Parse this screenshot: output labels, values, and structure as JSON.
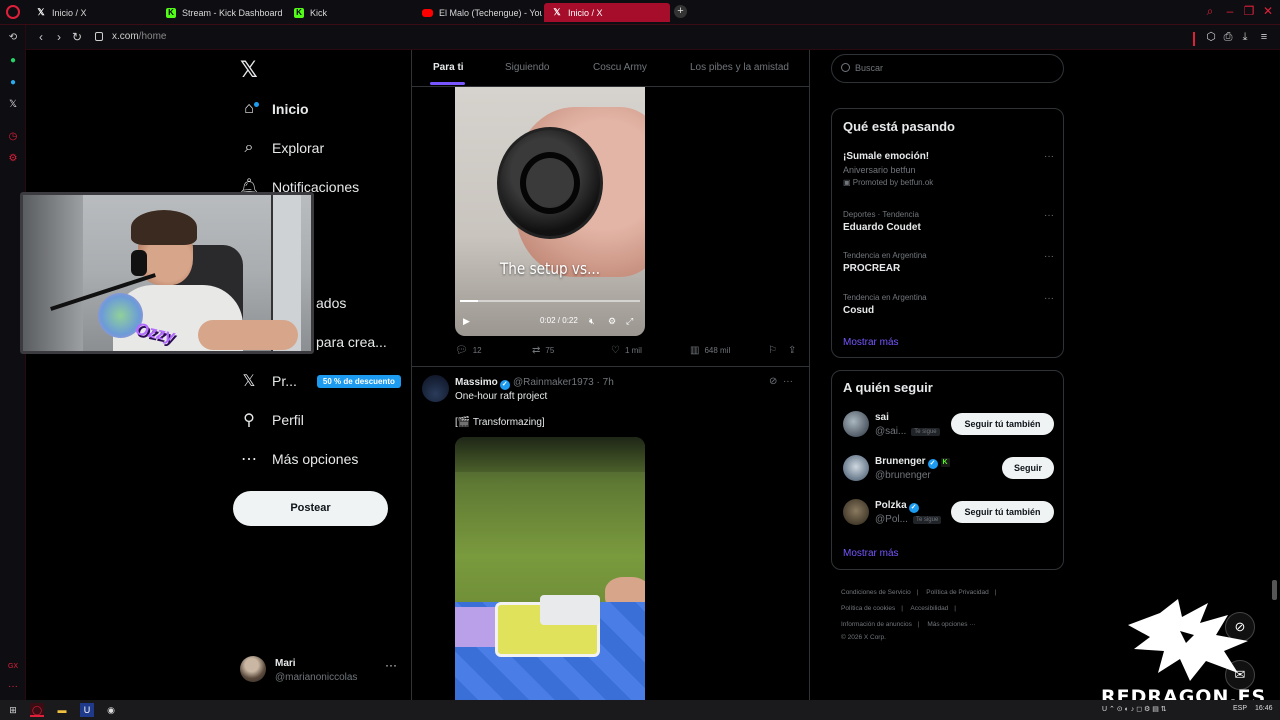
{
  "browser": {
    "tabs": [
      {
        "label": "Inicio / X",
        "icon": "x-logo-icon"
      },
      {
        "label": "Stream - Kick Dashboard",
        "icon": "kick-icon"
      },
      {
        "label": "Kick",
        "icon": "kick-icon"
      },
      {
        "label": "El Malo (Techengue) - You",
        "icon": "youtube-icon"
      },
      {
        "label": "Inicio / X",
        "icon": "x-logo-icon",
        "active": true
      }
    ],
    "new_tab": "+",
    "url_host": "x.com",
    "url_path": "/home",
    "accent": "#e0203a"
  },
  "nav": {
    "items": [
      {
        "label": "Inicio",
        "icon": "home-icon",
        "active": true
      },
      {
        "label": "Explorar",
        "icon": "search-icon"
      },
      {
        "label": "Notificaciones",
        "icon": "bell-icon"
      },
      {
        "label": "ados",
        "icon": "bookmark-icon"
      },
      {
        "label": "para crea...",
        "icon": "creator-icon"
      },
      {
        "label": "Pr...",
        "icon": "x-premium-icon",
        "badge": "50 % de descuento"
      },
      {
        "label": "Perfil",
        "icon": "profile-icon"
      },
      {
        "label": "Más opciones",
        "icon": "more-options-icon"
      }
    ],
    "post_button": "Postear",
    "account": {
      "name": "Mari",
      "handle": "@marianoniccolas",
      "more": "···"
    }
  },
  "webcam": {
    "overlay_logo": "Ozzy"
  },
  "feed": {
    "tabs": [
      {
        "label": "Para ti",
        "active": true
      },
      {
        "label": "Siguiendo"
      },
      {
        "label": "Coscu Army"
      },
      {
        "label": "Los pibes y la amistad"
      }
    ],
    "tweet1": {
      "video_caption": "The setup vs...",
      "video_time": "0:02 / 0:22",
      "video_progress": 0.1,
      "replies": "12",
      "reposts": "75",
      "likes": "1 mil",
      "views": "648 mil"
    },
    "tweet2": {
      "name": "Massimo",
      "handle": "@Rainmaker1973 · 7h",
      "text": "One-hour raft project",
      "text2": "[🎬 Transformazing]"
    }
  },
  "right": {
    "search_placeholder": "Buscar",
    "trending": {
      "title": "Qué está pasando",
      "items": [
        {
          "meta": "",
          "name": "¡Sumale emoción!",
          "sub": "Aniversario betfun",
          "promo": "Promoted by betfun.ok"
        },
        {
          "meta": "Deportes · Tendencia",
          "name": "Eduardo Coudet"
        },
        {
          "meta": "Tendencia en Argentina",
          "name": "PROCREAR"
        },
        {
          "meta": "Tendencia en Argentina",
          "name": "Cosud"
        }
      ],
      "show_more": "Mostrar más"
    },
    "who_to_follow": {
      "title": "A quién seguir",
      "items": [
        {
          "name": "sai",
          "handle": "@sai...",
          "follows_you": "Te sigue",
          "button": "Seguir tú también"
        },
        {
          "name": "Brunenger",
          "handle": "@brunenger",
          "button": "Seguir",
          "badge": "K"
        },
        {
          "name": "Polzka",
          "handle": "@Pol...",
          "follows_you": "Te sigue",
          "button": "Seguir tú también"
        }
      ],
      "show_more": "Mostrar más"
    },
    "footer": [
      "Condiciones de Servicio",
      "|",
      "Política de Privacidad",
      "|",
      "Política de cookies",
      "|",
      "Accesibilidad",
      "|",
      "Información de anuncios",
      "|",
      "Más opciones ···",
      "© 2026 X Corp."
    ]
  },
  "overlay": {
    "brand": "REDRAGON.ES"
  },
  "taskbar": {
    "lang": "ESP",
    "time": "16:46",
    "side_label": "GX"
  }
}
